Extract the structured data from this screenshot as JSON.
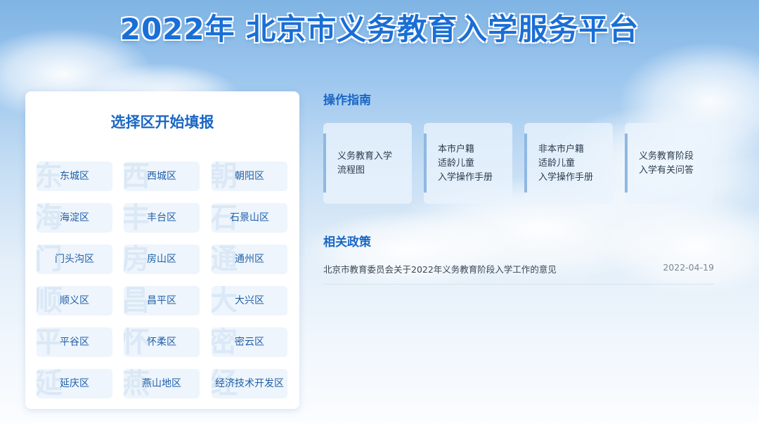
{
  "header": {
    "title": "2022年 北京市义务教育入学服务平台"
  },
  "district_panel": {
    "title": "选择区开始填报",
    "districts": [
      {
        "label": "东城区",
        "watermark": "东"
      },
      {
        "label": "西城区",
        "watermark": "西"
      },
      {
        "label": "朝阳区",
        "watermark": "朝"
      },
      {
        "label": "海淀区",
        "watermark": "海"
      },
      {
        "label": "丰台区",
        "watermark": "丰"
      },
      {
        "label": "石景山区",
        "watermark": "石"
      },
      {
        "label": "门头沟区",
        "watermark": "门"
      },
      {
        "label": "房山区",
        "watermark": "房"
      },
      {
        "label": "通州区",
        "watermark": "通"
      },
      {
        "label": "顺义区",
        "watermark": "顺"
      },
      {
        "label": "昌平区",
        "watermark": "昌"
      },
      {
        "label": "大兴区",
        "watermark": "大"
      },
      {
        "label": "平谷区",
        "watermark": "平"
      },
      {
        "label": "怀柔区",
        "watermark": "怀"
      },
      {
        "label": "密云区",
        "watermark": "密"
      },
      {
        "label": "延庆区",
        "watermark": "延"
      },
      {
        "label": "燕山地区",
        "watermark": "燕"
      },
      {
        "label": "经济技术开发区",
        "watermark": "经"
      }
    ]
  },
  "guide": {
    "title": "操作指南",
    "cards": [
      {
        "lines": [
          "义务教育入学",
          "流程图"
        ]
      },
      {
        "lines": [
          "本市户籍",
          "适龄儿童",
          "入学操作手册"
        ]
      },
      {
        "lines": [
          "非本市户籍",
          "适龄儿童",
          "入学操作手册"
        ]
      },
      {
        "lines": [
          "义务教育阶段",
          "入学有关问答"
        ]
      }
    ]
  },
  "policy": {
    "title": "相关政策",
    "items": [
      {
        "title": "北京市教育委员会关于2022年义务教育阶段入学工作的意见",
        "date": "2022-04-19"
      }
    ]
  }
}
